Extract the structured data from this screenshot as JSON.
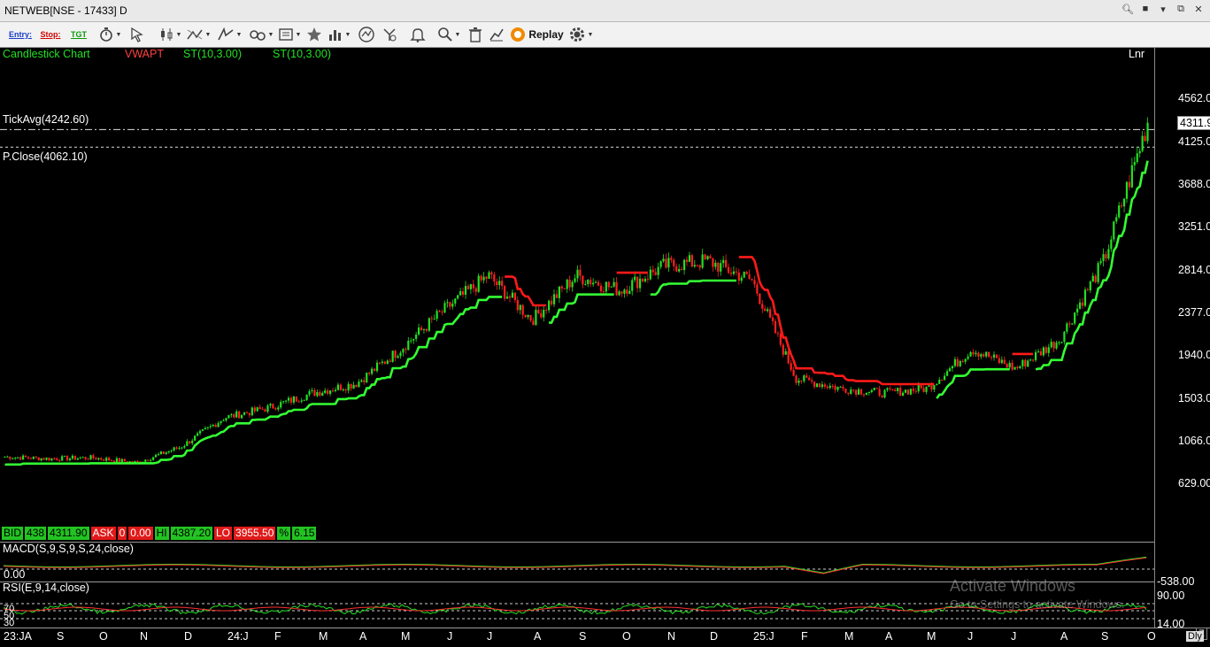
{
  "window": {
    "title": "NETWEB[NSE - 17433] D",
    "controls": [
      "search-icon",
      "user-icon",
      "dropdown-icon",
      "restore-icon",
      "close-icon"
    ]
  },
  "toolbar": {
    "entry_label": "Entry:",
    "stop_label": "Stop:",
    "tgt_label": "TGT",
    "replay_label": "Replay",
    "icons": [
      "timer-icon",
      "cursor-icon",
      "candle-type-icon",
      "drawing-tools-icon",
      "line-tool-icon",
      "link-icon",
      "template-icon",
      "favorite-star-icon",
      "indicators-icon",
      "scanner-icon",
      "strategy-icon",
      "alert-bell-icon",
      "zoom-icon",
      "delete-icon",
      "compare-icon",
      "replay-icon",
      "settings-gear-icon"
    ]
  },
  "legend": {
    "chart_type": "Candlestick Chart",
    "vwapt": "VWAPT",
    "st1": "ST(10,3.00)",
    "st2": "ST(10,3.00)",
    "scale": "Lnr",
    "tick_avg": "TickAvg(4242.60)",
    "prev_close": "P.Close(4062.10)",
    "last_price": "4311.90"
  },
  "quote": {
    "bid_label": "BID",
    "bid_qty": "438",
    "bid_price": "4311.90",
    "ask_label": "ASK",
    "ask_qty": "0",
    "ask_price": "0.00",
    "hi_label": "HI",
    "hi_value": "4387.20",
    "lo_label": "LO",
    "lo_value": "3955.50",
    "pct_label": "%",
    "pct_value": "6.15"
  },
  "macd": {
    "label": "MACD(S,9,S,9,S,24,close)",
    "zero": "0.00",
    "axis_min": "-538.00"
  },
  "rsi": {
    "label": "RSI(E,9,14,close)",
    "levels": [
      "70",
      "50",
      "30"
    ],
    "axis_top": "90.00",
    "axis_bottom": "14.00"
  },
  "price_axis": [
    "4562.00",
    "4125.00",
    "3688.00",
    "3251.00",
    "2814.00",
    "2377.00",
    "1940.00",
    "1503.00",
    "1066.00",
    "629.00"
  ],
  "time_axis": [
    "23:JA",
    "S",
    "O",
    "N",
    "D",
    "24:J",
    "F",
    "M",
    "A",
    "M",
    "J",
    "J",
    "A",
    "S",
    "O",
    "N",
    "D",
    "25:J",
    "F",
    "M",
    "A",
    "M",
    "J",
    "J",
    "A",
    "S",
    "O"
  ],
  "bottom_right": {
    "z": "Z",
    "period": "Dly"
  },
  "watermark": {
    "line1": "Activate Windows",
    "line2": "Go to Settings to activate Windows."
  },
  "colors": {
    "up": "#22e022",
    "down": "#ff2020",
    "supertrend_up": "#33ff33",
    "supertrend_down": "#ff1a1a",
    "background": "#000000"
  },
  "chart_data": {
    "type": "candlestick",
    "symbol": "NETWEB",
    "y_scale": "linear",
    "ylim": [
      629,
      4562
    ],
    "close_series": [
      {
        "x": "23:JA",
        "y": 900
      },
      {
        "x": "S",
        "y": 880
      },
      {
        "x": "O",
        "y": 890
      },
      {
        "x": "N",
        "y": 840
      },
      {
        "x": "D",
        "y": 1000
      },
      {
        "x": "24:J",
        "y": 1300
      },
      {
        "x": "F",
        "y": 1400
      },
      {
        "x": "M",
        "y": 1550
      },
      {
        "x": "A",
        "y": 1650
      },
      {
        "x": "M",
        "y": 2000
      },
      {
        "x": "J",
        "y": 2400
      },
      {
        "x": "J",
        "y": 2750
      },
      {
        "x": "A",
        "y": 2300
      },
      {
        "x": "S",
        "y": 2750
      },
      {
        "x": "O",
        "y": 2600
      },
      {
        "x": "N",
        "y": 2850
      },
      {
        "x": "D",
        "y": 2900
      },
      {
        "x": "25:J",
        "y": 2700
      },
      {
        "x": "F",
        "y": 1700
      },
      {
        "x": "M",
        "y": 1600
      },
      {
        "x": "A",
        "y": 1550
      },
      {
        "x": "M",
        "y": 1600
      },
      {
        "x": "J",
        "y": 2000
      },
      {
        "x": "J",
        "y": 1800
      },
      {
        "x": "A",
        "y": 2100
      },
      {
        "x": "S",
        "y": 2900
      },
      {
        "x": "O",
        "y": 4311.9
      }
    ],
    "tick_avg": 4242.6,
    "prev_close": 4062.1,
    "last": 4311.9
  }
}
